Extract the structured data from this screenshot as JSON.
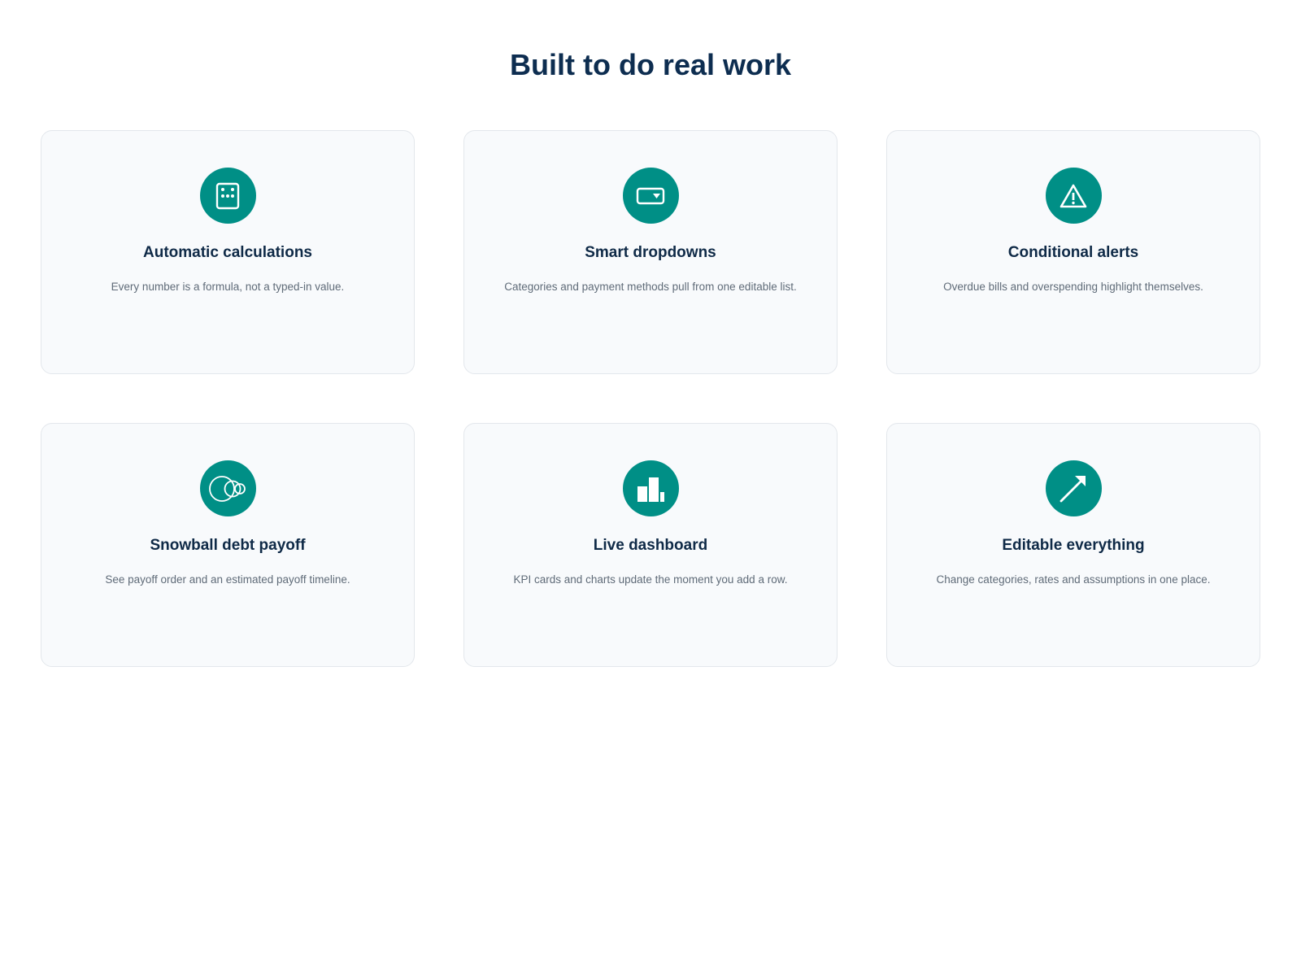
{
  "section": {
    "title": "Built to do real work"
  },
  "colors": {
    "accent": "#008f86",
    "heading": "#0d2d50",
    "card_background": "#f8fafc",
    "card_border": "#e3e7ec",
    "description": "#5f6b78"
  },
  "features": [
    {
      "icon": "calculator-icon",
      "title": "Automatic calculations",
      "description": "Every number is a formula, not a typed-in value."
    },
    {
      "icon": "dropdown-icon",
      "title": "Smart dropdowns",
      "description": "Categories and payment methods pull from one editable list."
    },
    {
      "icon": "warning-icon",
      "title": "Conditional alerts",
      "description": "Overdue bills and overspending highlight themselves."
    },
    {
      "icon": "snowball-icon",
      "title": "Snowball debt payoff",
      "description": "See payoff order and an estimated payoff timeline."
    },
    {
      "icon": "bar-chart-icon",
      "title": "Live dashboard",
      "description": "KPI cards and charts update the moment you add a row."
    },
    {
      "icon": "trend-arrow-icon",
      "title": "Editable everything",
      "description": "Change categories, rates and assumptions in one place."
    }
  ]
}
